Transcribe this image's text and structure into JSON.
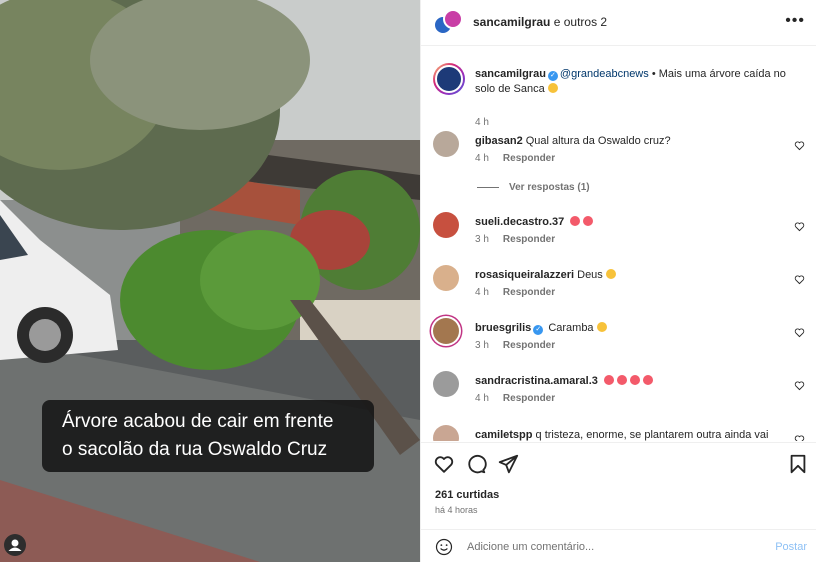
{
  "media": {
    "caption_line1": "Árvore acabou de cair em frente",
    "caption_line2": "o sacolão da rua Oswaldo Cruz"
  },
  "header": {
    "username": "sancamilgrau",
    "collab_suffix": " e outros 2",
    "more_icon": "more-options-icon"
  },
  "post_caption": {
    "username": "sancamilgrau",
    "mention": "@grandeabcnews",
    "text": " • Mais uma árvore caída no solo de Sanca",
    "time": "4 h"
  },
  "comments": [
    {
      "user": "gibasan2",
      "text": "Qual altura da Oswaldo cruz?",
      "time": "4 h",
      "reply": "Responder",
      "avatar_color": "#b8a89a"
    },
    {
      "user": "sueli.decastro.37",
      "text": "",
      "time": "3 h",
      "reply": "Responder",
      "avatar_color": "#c7503f"
    },
    {
      "user": "rosasiqueiralazzeri",
      "text": "Deus",
      "time": "4 h",
      "reply": "Responder",
      "avatar_color": "#d9b08c"
    },
    {
      "user": "bruesgrilis",
      "text": "Caramba",
      "time": "3 h",
      "reply": "Responder",
      "avatar_color": "#a3774f"
    },
    {
      "user": "sandracristina.amaral.3",
      "text": "",
      "time": "4 h",
      "reply": "Responder",
      "avatar_color": "#9b9b9b"
    },
    {
      "user": "camiletspp",
      "text": "q tristeza, enorme, se plantarem outra ainda vai",
      "time": "",
      "reply": "",
      "avatar_color": "#c9a693"
    }
  ],
  "view_replies": "Ver respostas (1)",
  "actions": {
    "likes": "261 curtidas",
    "time_ago": "há 4 horas"
  },
  "add_comment": {
    "placeholder": "Adicione um comentário...",
    "post_label": "Postar"
  }
}
